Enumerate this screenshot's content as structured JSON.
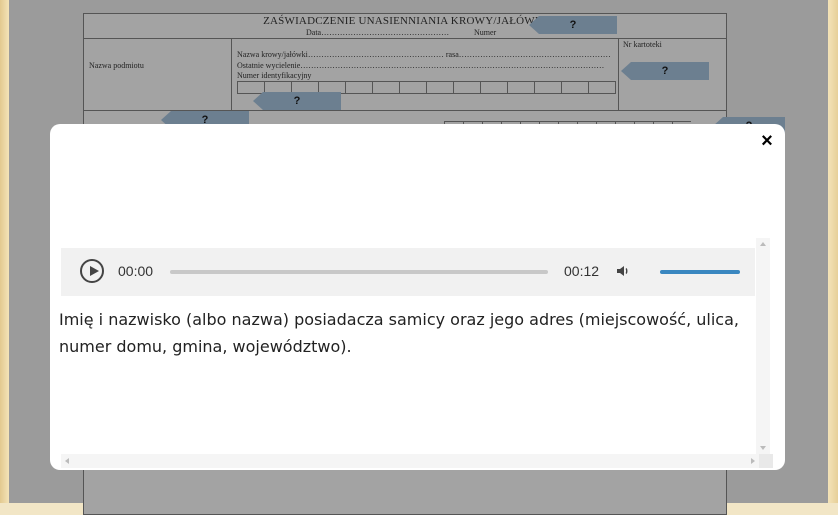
{
  "document": {
    "title": "ZAŚWIADCZENIE UNASIENNIANIA KROWY/JAŁÓWKI",
    "data_label": "Data…………………………………………",
    "numer_label": "Numer",
    "nazwa_podmiotu": "Nazwa podmiotu",
    "nr_kartoteki": "Nr kartoteki",
    "nazwa_krowy": "Nazwa krowy/jałówki……………………………………………    rasa…………………………………………………",
    "ostatnie_wycielenie": "Ostatnie wycielenie……………………………………………………………………………………………………",
    "numer_identyfikacyjny": "Numer  identyfikacyjny",
    "hint_marker": "?"
  },
  "audio": {
    "current_time": "00:00",
    "duration": "00:12",
    "volume_level": 1.0
  },
  "modal": {
    "close_label": "×",
    "description": "Imię i nazwisko (albo nazwa) posiadacza samicy oraz jego adres (miejscowość, ulica, numer domu, gmina, województwo)."
  }
}
